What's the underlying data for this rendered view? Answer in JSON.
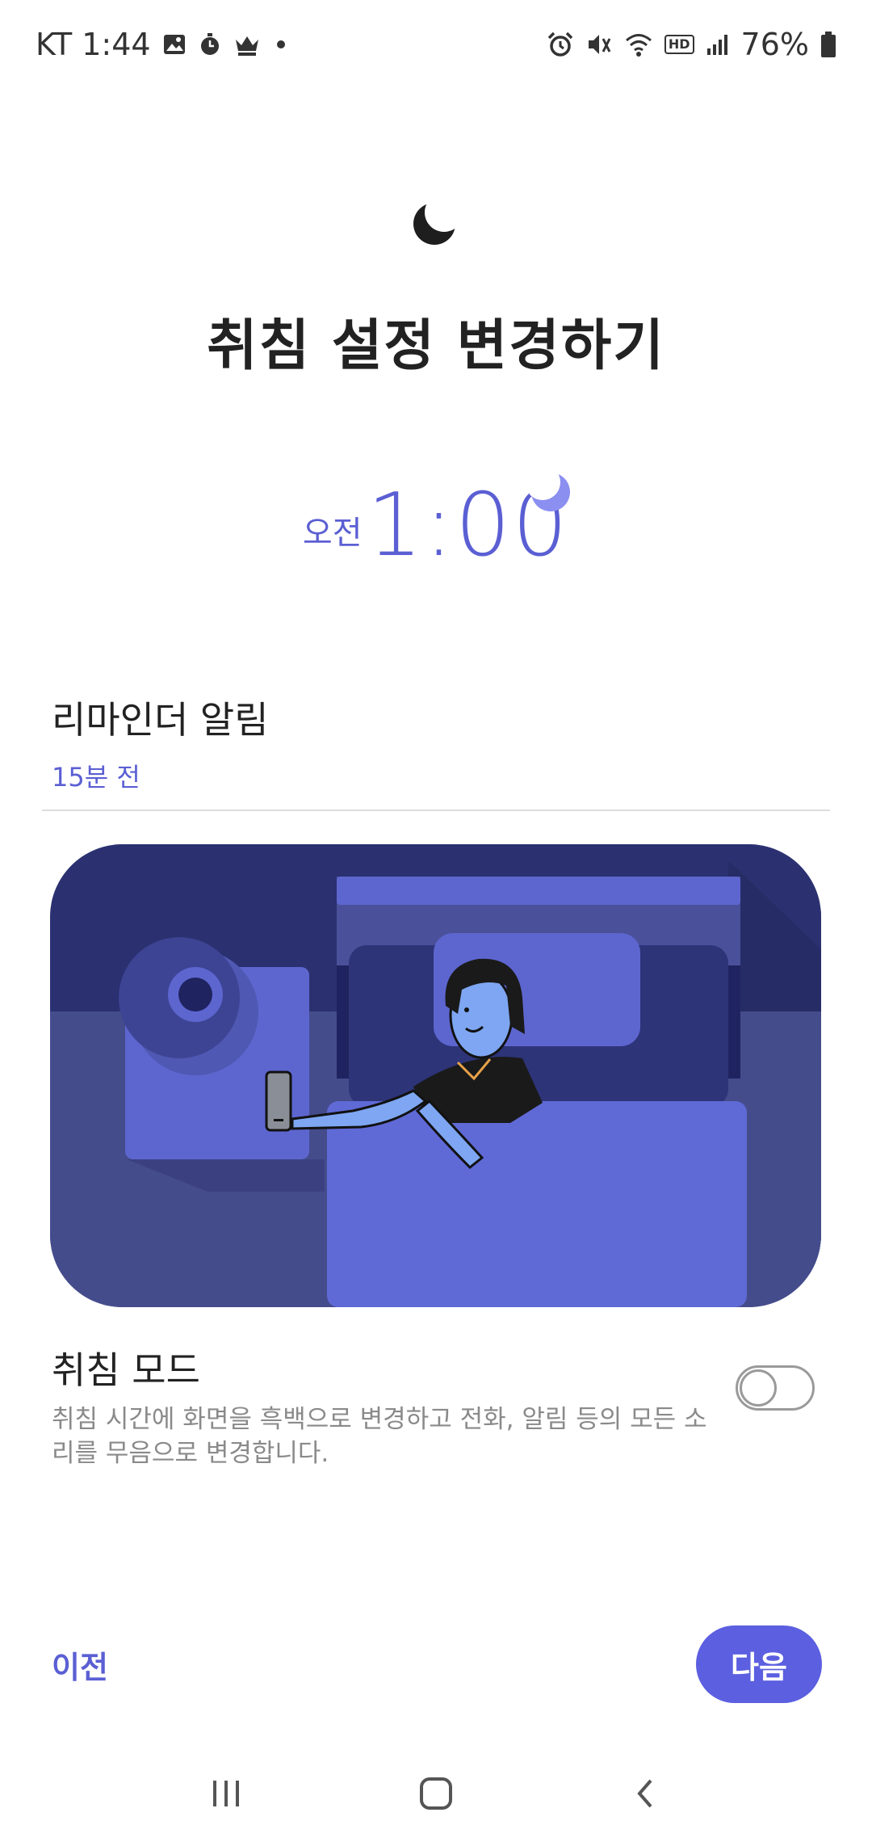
{
  "status_bar": {
    "carrier_time": "KT 1:44",
    "battery": "76%",
    "hd_label": "HD",
    "left_icons": [
      "image-icon",
      "stopwatch-icon",
      "crown-icon",
      "dot-icon"
    ],
    "right_icons": [
      "alarm-icon",
      "mute-icon",
      "wifi-icon",
      "hd-icon",
      "signal-icon",
      "battery-icon"
    ]
  },
  "header": {
    "icon": "moon-icon",
    "title": "취침 설정 변경하기"
  },
  "bedtime": {
    "ampm": "오전",
    "time": "1:00",
    "icon": "moon-icon"
  },
  "reminder": {
    "title": "리마인더 알림",
    "value": "15분 전"
  },
  "bedtime_mode": {
    "title": "취침 모드",
    "description": "취침 시간에 화면을 흑백으로 변경하고 전화, 알림 등의 모든 소리를 무음으로 변경합니다.",
    "enabled": false
  },
  "actions": {
    "prev_label": "이전",
    "next_label": "다음"
  },
  "nav_bar": {
    "recent": "recent-apps-icon",
    "home": "home-icon",
    "back": "back-icon"
  },
  "colors": {
    "accent": "#5b5fd3",
    "button": "#5b5fe0",
    "illustration_bg": "#3d437f"
  }
}
